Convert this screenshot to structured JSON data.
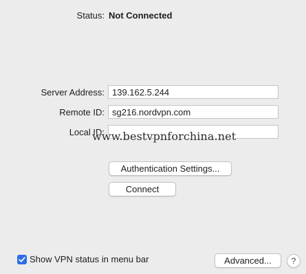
{
  "status": {
    "label": "Status:",
    "value": "Not Connected"
  },
  "fields": {
    "server_address": {
      "label": "Server Address:",
      "value": "139.162.5.244"
    },
    "remote_id": {
      "label": "Remote ID:",
      "value": "sg216.nordvpn.com"
    },
    "local_id": {
      "label": "Local ID:",
      "value": ""
    }
  },
  "watermark": "www.bestvpnforchina.net",
  "buttons": {
    "auth_settings": "Authentication Settings...",
    "connect": "Connect",
    "advanced": "Advanced...",
    "help": "?"
  },
  "menu_bar_option": {
    "label": "Show VPN status in menu bar",
    "checked": true
  },
  "colors": {
    "background": "#ececec",
    "accent": "#2b6ee6"
  }
}
